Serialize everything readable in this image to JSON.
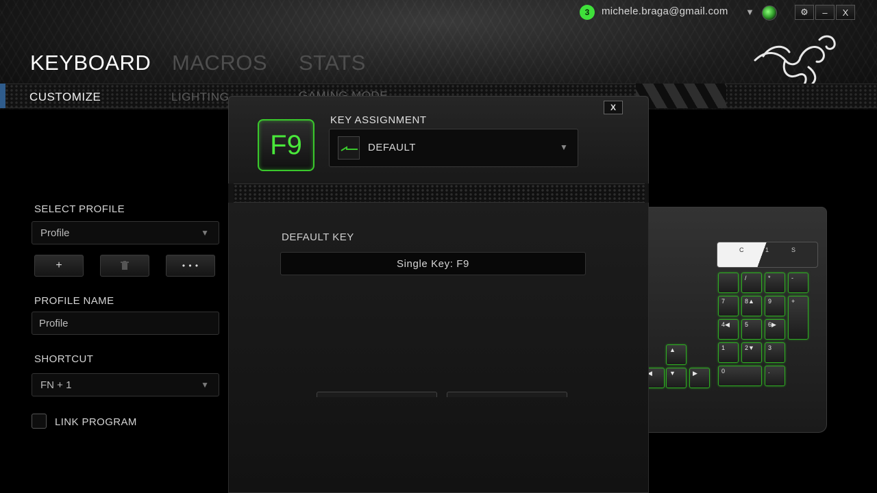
{
  "header": {
    "notification_count": "3",
    "user_email": "michele.braga@gmail.com",
    "window_buttons": {
      "settings": "⚙",
      "minimize": "–",
      "close": "X"
    },
    "main_tabs": [
      {
        "label": "KEYBOARD",
        "active": true
      },
      {
        "label": "MACROS",
        "active": false
      },
      {
        "label": "STATS",
        "active": false
      }
    ],
    "sub_tabs": [
      {
        "label": "CUSTOMIZE",
        "active": true
      },
      {
        "label": "LIGHTING",
        "active": false
      },
      {
        "label": "GAMING MODE",
        "active": false
      }
    ]
  },
  "left_panel": {
    "select_profile_label": "SELECT PROFILE",
    "profile_select_value": "Profile",
    "add_button": "+",
    "delete_button": "🗑",
    "more_button": "• • •",
    "profile_name_label": "PROFILE NAME",
    "profile_name_value": "Profile",
    "shortcut_label": "SHORTCUT",
    "shortcut_value": "FN + 1",
    "link_program_label": "LINK PROGRAM",
    "link_program_checked": false
  },
  "dialog": {
    "close_label": "X",
    "key_name": "F9",
    "key_assignment_label": "KEY ASSIGNMENT",
    "key_assignment_value": "DEFAULT",
    "default_key_label": "DEFAULT KEY",
    "default_key_value": "Single Key: F9"
  },
  "keyboard_preview": {
    "media_labels": [
      "C",
      "1",
      "S"
    ],
    "keys": [
      {
        "label": "",
        "row": 0,
        "col": 0
      },
      {
        "label": "/",
        "row": 0,
        "col": 1
      },
      {
        "label": "*",
        "row": 0,
        "col": 2
      },
      {
        "label": "-",
        "row": 0,
        "col": 3
      },
      {
        "label": "7",
        "row": 1,
        "col": 0
      },
      {
        "label": "8▲",
        "row": 1,
        "col": 1
      },
      {
        "label": "9",
        "row": 1,
        "col": 2
      },
      {
        "label": "+",
        "row": 1,
        "col": 3
      },
      {
        "label": "4◀",
        "row": 2,
        "col": 0
      },
      {
        "label": "5",
        "row": 2,
        "col": 1
      },
      {
        "label": "6▶",
        "row": 2,
        "col": 2
      },
      {
        "label": "1",
        "row": 3,
        "col": 0
      },
      {
        "label": "2▼",
        "row": 3,
        "col": 1
      },
      {
        "label": "3",
        "row": 3,
        "col": 2
      },
      {
        "label": "0",
        "row": 4,
        "col": 0
      },
      {
        "label": ".",
        "row": 4,
        "col": 2
      }
    ]
  },
  "colors": {
    "accent_green": "#3ac82c",
    "accent_blue": "#2f5c8c"
  }
}
